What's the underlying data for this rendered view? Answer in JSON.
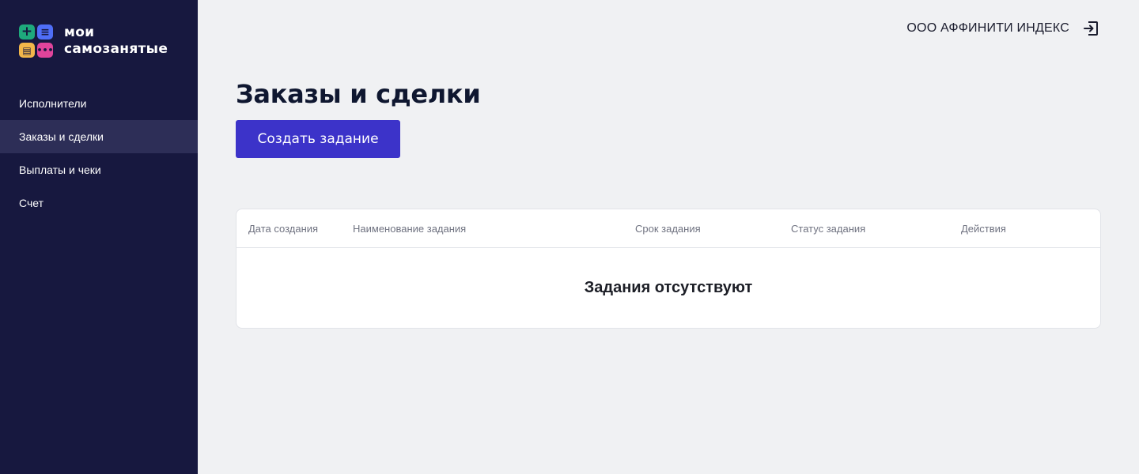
{
  "logo": {
    "line1": "мои",
    "line2": "самозанятые",
    "tiles": [
      {
        "icon": "plus-icon",
        "glyph": "+",
        "color": "#1ea97c"
      },
      {
        "icon": "list-icon",
        "glyph": "≡",
        "color": "#4f6ef7"
      },
      {
        "icon": "document-icon",
        "glyph": "▤",
        "color": "#f2b64a"
      },
      {
        "icon": "chat-icon",
        "glyph": "•••",
        "color": "#e0449b"
      }
    ]
  },
  "sidebar": {
    "items": [
      {
        "label": "Исполнители",
        "active": false
      },
      {
        "label": "Заказы и сделки",
        "active": true
      },
      {
        "label": "Выплаты и чеки",
        "active": false
      },
      {
        "label": "Счет",
        "active": false
      }
    ]
  },
  "header": {
    "company": "ООО АФФИНИТИ ИНДЕКС",
    "logout_icon": "logout-icon"
  },
  "main": {
    "title": "Заказы и сделки",
    "create_button": "Создать задание"
  },
  "table": {
    "columns": [
      "Дата создания",
      "Наименование задания",
      "Срок задания",
      "Статус задания",
      "Действия"
    ],
    "rows": [],
    "empty_text": "Задания отсутствуют"
  },
  "colors": {
    "sidebar_bg": "#17183f",
    "sidebar_active": "#2d2e57",
    "accent": "#3c33c9",
    "page_bg": "#f0f1f3"
  }
}
